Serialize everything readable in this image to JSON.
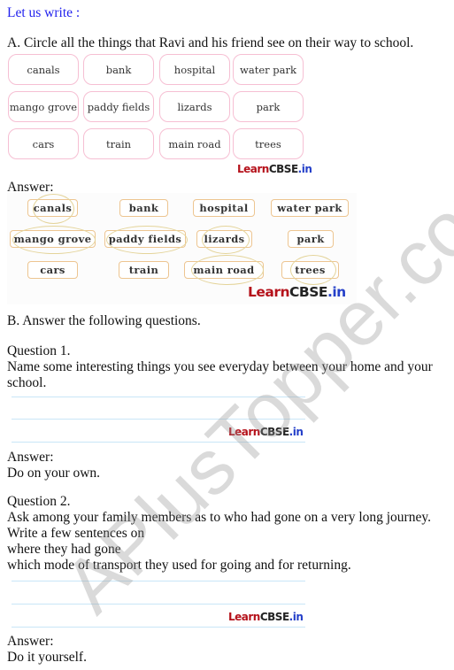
{
  "section_heading": "Let us write :",
  "part_a": {
    "instruction": "A. Circle all the things that Ravi and his friend see on their way to school.",
    "items": [
      [
        "canals",
        "bank",
        "hospital",
        "water park"
      ],
      [
        "mango grove",
        "paddy fields",
        "lizards",
        "park"
      ],
      [
        "cars",
        "train",
        "main road",
        "trees"
      ]
    ],
    "answer_label": "Answer:",
    "circled_items": [
      "canals",
      "mango grove",
      "paddy fields",
      "lizards",
      "main road",
      "trees"
    ]
  },
  "logo": {
    "learn": "Learn",
    "cbse": "CBSE",
    "in": ".in"
  },
  "part_b": {
    "instruction": "B. Answer the following questions.",
    "questions": [
      {
        "label": "Question 1.",
        "text": "Name some interesting things you see everyday between your home and your school.",
        "text_line1": "Name some interesting things you see everyday between your home and your",
        "text_line2": "school.",
        "answer_label": "Answer:",
        "answer": "Do on your own."
      },
      {
        "label": "Question 2.",
        "lines": [
          "Ask among your family members as to who had gone on a very long journey.",
          "Write a few sentences on",
          "where they had gone",
          "which mode of transport they used for going and for returning."
        ],
        "answer_label": "Answer:",
        "answer": "Do it yourself."
      }
    ]
  },
  "watermark": "APlusTopper.com",
  "colors": {
    "heading": "#2222ee",
    "question_box_border": "#f6bfd3",
    "answer_box_border": "#edc591",
    "writing_line": "#c9e6f7",
    "logo_learn": "#b5121b",
    "logo_in": "#2540c9"
  }
}
